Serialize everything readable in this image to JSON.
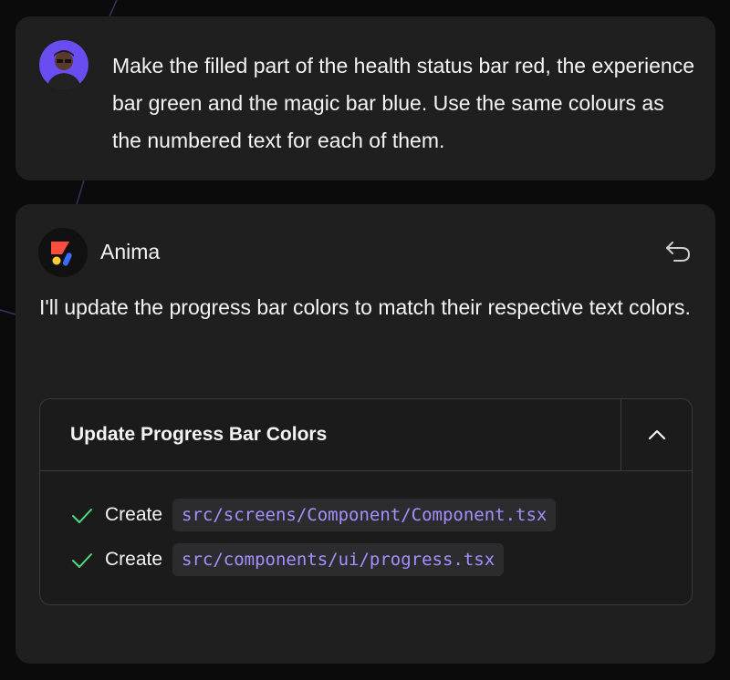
{
  "user_message": {
    "text": "Make the filled part of the health status bar red, the experience bar green and the magic bar blue. Use the same colours as the numbered text for each of them."
  },
  "assistant": {
    "name": "Anima",
    "reply": "I'll update the progress bar colors to match their respective text colors.",
    "task": {
      "title": "Update Progress Bar Colors",
      "items": [
        {
          "action": "Create",
          "file": "src/screens/Component/Component.tsx"
        },
        {
          "action": "Create",
          "file": "src/components/ui/progress.tsx"
        }
      ]
    }
  },
  "colors": {
    "background": "#0b0b0c",
    "card": "#1f1f20",
    "file_path": "#a690ff",
    "check": "#4ade80",
    "logo_red": "#ff4d3d",
    "logo_yellow": "#ffcc33",
    "logo_blue": "#3b6bff",
    "avatar_bg": "#6a4df0"
  },
  "icons": {
    "undo": "undo-icon",
    "collapse": "chevron-up-icon",
    "done": "check-icon"
  }
}
